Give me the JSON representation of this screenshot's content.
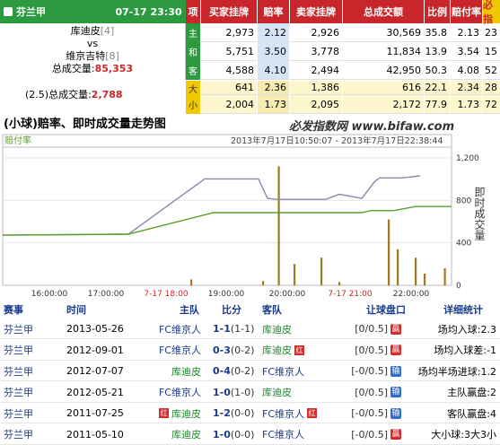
{
  "header": {
    "league": "芬兰甲",
    "datetime": "07-17 23:30",
    "col_item": "项",
    "col_buy": "买家挂牌",
    "col_odds": "赔率",
    "col_sell": "卖家挂牌",
    "col_volume": "总成交额",
    "col_ratio": "比例",
    "col_pay": "赔付率",
    "col_must": "必指"
  },
  "match": {
    "home": "库迪皮",
    "home_rank": "[4]",
    "vs": "vs",
    "away": "维京吉特",
    "away_rank": "[8]",
    "total_label": "总成交量:",
    "total": "85,353",
    "ou_label": "(2.5)总成交量:",
    "ou_total": "2,788"
  },
  "rows": [
    {
      "label": "主",
      "buy": "2,973",
      "odds": "2.12",
      "sell": "2,926",
      "volume": "30,569",
      "ratio": "35.8",
      "pay": "2.13",
      "must": "23"
    },
    {
      "label": "和",
      "buy": "5,751",
      "odds": "3.50",
      "sell": "3,778",
      "volume": "11,834",
      "ratio": "13.9",
      "pay": "3.54",
      "must": "15"
    },
    {
      "label": "客",
      "buy": "4,588",
      "odds": "4.10",
      "sell": "2,494",
      "volume": "42,950",
      "ratio": "50.3",
      "pay": "4.08",
      "must": "52"
    },
    {
      "label": "大",
      "buy": "641",
      "odds": "2.36",
      "sell": "1,386",
      "volume": "616",
      "ratio": "22.1",
      "pay": "2.34",
      "must": "28"
    },
    {
      "label": "小",
      "buy": "2,004",
      "odds": "1.73",
      "sell": "2,095",
      "volume": "2,172",
      "ratio": "77.9",
      "pay": "1.73",
      "must": "72"
    }
  ],
  "chart": {
    "title": "(小球)赔率、即时成交量走势图",
    "site": "必发指数网 www.bifaw.com",
    "legend": "赔付率",
    "range": "2013年7月17日10:50:07 - 2013年7月17日22:38:44",
    "y2label": "即时成交量"
  },
  "chart_data": {
    "type": "line",
    "x_ticks": [
      "16:00:00",
      "17:00:00",
      "7-17 18:00",
      "19:00:00",
      "20:00:00",
      "7-17 21:00",
      "22:00:00"
    ],
    "y2_ticks": [
      "1,200",
      "800",
      "400",
      "0"
    ],
    "y2lim": [
      0,
      1200
    ],
    "series": [
      {
        "name": "",
        "color": "#8888aa",
        "points": [
          [
            0,
            0.42
          ],
          [
            0.28,
            0.43
          ],
          [
            0.45,
            0.97
          ],
          [
            0.57,
            0.97
          ],
          [
            0.59,
            0.78
          ],
          [
            0.61,
            0.77
          ],
          [
            0.72,
            0.77
          ],
          [
            0.75,
            0.82
          ],
          [
            0.8,
            0.78
          ],
          [
            0.83,
            0.95
          ],
          [
            0.84,
            0.98
          ],
          [
            0.89,
            0.98
          ],
          [
            0.93,
            1.0
          ]
        ]
      },
      {
        "name": "",
        "color": "#5aa02c",
        "points": [
          [
            0,
            0.42
          ],
          [
            0.28,
            0.43
          ],
          [
            0.47,
            0.64
          ],
          [
            0.59,
            0.64
          ],
          [
            0.77,
            0.64
          ],
          [
            0.8,
            0.64
          ],
          [
            0.82,
            0.66
          ],
          [
            0.87,
            0.66
          ],
          [
            0.92,
            0.7
          ],
          [
            1,
            0.7
          ]
        ]
      }
    ],
    "bars": [
      [
        0.42,
        55
      ],
      [
        0.58,
        40
      ],
      [
        0.615,
        1120
      ],
      [
        0.65,
        200
      ],
      [
        0.71,
        260
      ],
      [
        0.75,
        30
      ],
      [
        0.86,
        620
      ],
      [
        0.88,
        340
      ],
      [
        0.92,
        260
      ],
      [
        0.94,
        110
      ],
      [
        0.985,
        160
      ]
    ]
  },
  "table": {
    "headers": [
      "赛事",
      "时间",
      "主队",
      "比分",
      "客队",
      "让球盘口",
      "详细统计"
    ],
    "rows": [
      {
        "league": "芬兰甲",
        "date": "2013-05-26",
        "home": "FC维京人",
        "score": "1-1",
        "half": "(1-1)",
        "away": "库迪皮",
        "line": "[0/0.5]",
        "result": "赢",
        "stat": "场均入球:2.3",
        "home_flag": "",
        "away_flag": ""
      },
      {
        "league": "芬兰甲",
        "date": "2012-09-01",
        "home": "FC维京人",
        "score": "0-3",
        "half": "(0-2)",
        "away": "库迪皮",
        "line": "[0/0.5]",
        "result": "赢",
        "stat": "场均入球差:-1",
        "home_flag": "",
        "away_flag": "红"
      },
      {
        "league": "芬兰甲",
        "date": "2012-07-07",
        "home": "库迪皮",
        "score": "0-4",
        "half": "(0-2)",
        "away": "FC维京人",
        "line": "[-0/0.5]",
        "result": "输",
        "stat": "场均半场进球:1.2",
        "home_flag": "",
        "away_flag": ""
      },
      {
        "league": "芬兰甲",
        "date": "2012-05-21",
        "home": "FC维京人",
        "score": "1-0",
        "half": "(1-0)",
        "away": "库迪皮",
        "line": "[0/0.5]",
        "result": "输",
        "stat": "主队赢盘:2",
        "home_flag": "",
        "away_flag": ""
      },
      {
        "league": "芬兰甲",
        "date": "2011-07-25",
        "home": "库迪皮",
        "score": "1-2",
        "half": "(0-0)",
        "away": "FC维京人",
        "line": "[-0/0.5]",
        "result": "输",
        "stat": "客队赢盘:4",
        "home_flag": "红",
        "away_flag": "红"
      },
      {
        "league": "芬兰甲",
        "date": "2011-05-10",
        "home": "库迪皮",
        "score": "1-0",
        "half": "(0-0)",
        "away": "FC维京人",
        "line": "[-0/0.5]",
        "result": "赢",
        "stat": "大小球:3大3小",
        "home_flag": "",
        "away_flag": ""
      }
    ]
  }
}
